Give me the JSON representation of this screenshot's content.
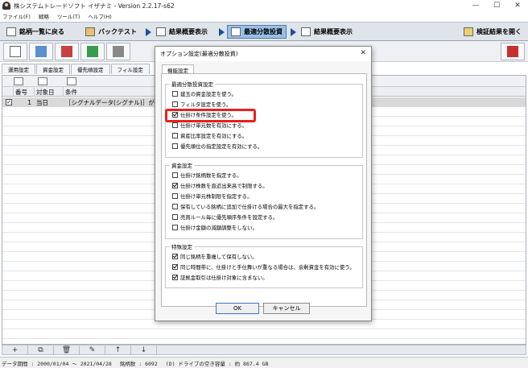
{
  "window": {
    "title": "株システムトレードソフト イザナミ - Version 2.2.17-s62",
    "controls": [
      "—",
      "☐",
      "✕"
    ]
  },
  "menu": [
    "ファイル(F)",
    "戦略",
    "ツール(T)",
    "ヘルプ(H)"
  ],
  "nav": {
    "back": "銘柄一覧に戻る",
    "backtest": "バックテスト",
    "summary": "結果概要表示",
    "optimize": "最適分散投資",
    "summary2": "結果概要表示",
    "open_results": "検証結果を開く"
  },
  "subtabs": [
    "運用設定",
    "資金設定",
    "優先順設定",
    "フィル設定"
  ],
  "grid": {
    "headers": [
      "番号",
      "対象日",
      "条件"
    ],
    "row": {
      "checked": "✓",
      "num": "1",
      "day": "当日",
      "cond": "［シグナルデータ(シグナル)］が［1"
    }
  },
  "bottom_buttons": [
    "+",
    "⧉",
    "🗑",
    "✎",
    "↑",
    "↓"
  ],
  "status": {
    "period": "データ期間 : 2000/01/04 〜 2021/04/28",
    "count": "銘柄数 : 6092",
    "disk": "(D) ドライブの空き容量 : 約 867.4 GB"
  },
  "dialog": {
    "title": "オプション設定(最適分散投資)",
    "close": "✕",
    "tab": "機能設定",
    "groups": [
      {
        "label": "最適分散投資設定",
        "options": [
          {
            "text": "建玉の資金設定を使う。",
            "checked": false
          },
          {
            "text": "フィルタ設定を使う。",
            "checked": false
          },
          {
            "text": "仕掛け条件設定を使う。",
            "checked": true
          },
          {
            "text": "仕掛け単元数を有効にする。",
            "checked": false
          },
          {
            "text": "資産比率設定を有効にする。",
            "checked": false
          },
          {
            "text": "優先順位の指定設定を有効にする。",
            "checked": false
          }
        ]
      },
      {
        "label": "資金設定",
        "options": [
          {
            "text": "仕掛け銘柄数を指定する。",
            "checked": false
          },
          {
            "text": "仕掛け株数を直近出来高で制限する。",
            "checked": true
          },
          {
            "text": "仕掛け単元株制限を指定する。",
            "checked": false
          },
          {
            "text": "保有している銘柄に追加で仕掛ける場合の最大を指定する。",
            "checked": false
          },
          {
            "text": "売買ルール毎に優先順序条件を設定する。",
            "checked": false
          },
          {
            "text": "仕掛け金額の減額調整をしない。",
            "checked": false
          }
        ]
      },
      {
        "label": "特殊設定",
        "options": [
          {
            "text": "同じ銘柄を重複して保有しない。",
            "checked": true
          },
          {
            "text": "同じ時間帯に、仕掛けと手仕舞いが重なる場合は、余剰資金を有効に使う。",
            "checked": true
          },
          {
            "text": "証拠金取引は仕掛け対象に含まない。",
            "checked": true
          }
        ]
      }
    ],
    "ok": "OK",
    "cancel": "キャンセル"
  },
  "colors": {
    "highlight": "#e8201d",
    "active_tab": "#9bc0e8",
    "nav_arrow": "#1a4fa0"
  }
}
